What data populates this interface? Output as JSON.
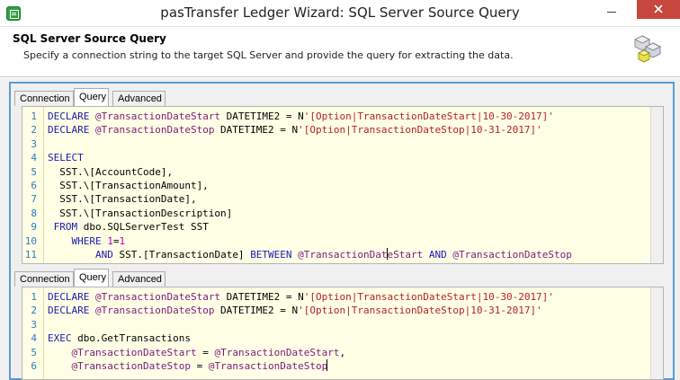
{
  "window": {
    "title": "pasTransfer Ledger Wizard: SQL Server Source Query",
    "minimize": "minimize",
    "maximize": "maximize",
    "close": "close"
  },
  "header": {
    "title": "SQL Server Source Query",
    "description": "Specify a connection string to the target SQL Server and provide the query for extracting the data."
  },
  "top_panel": {
    "tabs": [
      {
        "label": "Connection",
        "active": false
      },
      {
        "label": "Query",
        "active": true
      },
      {
        "label": "Advanced",
        "active": false
      }
    ],
    "lines": [
      {
        "n": "1",
        "tokens": [
          [
            "kw",
            "DECLARE "
          ],
          [
            "var",
            "@TransactionDateStart"
          ],
          [
            "txt",
            " DATETIME2 = N"
          ],
          [
            "str",
            "'[Option|TransactionDateStart|10-30-2017]'"
          ]
        ]
      },
      {
        "n": "2",
        "tokens": [
          [
            "kw",
            "DECLARE "
          ],
          [
            "var",
            "@TransactionDateStop"
          ],
          [
            "txt",
            " DATETIME2 = N"
          ],
          [
            "str",
            "'[Option|TransactionDateStop|10-31-2017]'"
          ]
        ]
      },
      {
        "n": "3",
        "tokens": []
      },
      {
        "n": "4",
        "tokens": [
          [
            "kw",
            "SELECT"
          ]
        ]
      },
      {
        "n": "5",
        "tokens": [
          [
            "txt",
            "  SST.\\[AccountCode],"
          ]
        ]
      },
      {
        "n": "6",
        "tokens": [
          [
            "txt",
            "  SST.\\[TransactionAmount],"
          ]
        ]
      },
      {
        "n": "7",
        "tokens": [
          [
            "txt",
            "  SST.\\[TransactionDate],"
          ]
        ]
      },
      {
        "n": "8",
        "tokens": [
          [
            "txt",
            "  SST.\\[TransactionDescription]"
          ]
        ]
      },
      {
        "n": "9",
        "tokens": [
          [
            "kw",
            " FROM "
          ],
          [
            "txt",
            "dbo.SQLServerTest SST"
          ]
        ]
      },
      {
        "n": "10",
        "tokens": [
          [
            "kw",
            "    WHERE "
          ],
          [
            "num",
            "1"
          ],
          [
            "txt",
            "="
          ],
          [
            "num",
            "1"
          ]
        ]
      },
      {
        "n": "11",
        "tokens": [
          [
            "kw",
            "        AND "
          ],
          [
            "txt",
            "SST.[TransactionDate] "
          ],
          [
            "kw",
            "BETWEEN "
          ],
          [
            "var",
            "@TransactionDat"
          ],
          [
            "caret",
            ""
          ],
          [
            "var",
            "eStart"
          ],
          [
            "kw",
            " AND "
          ],
          [
            "var",
            "@TransactionDateStop"
          ]
        ]
      }
    ]
  },
  "bottom_panel": {
    "tabs": [
      {
        "label": "Connection",
        "active": false
      },
      {
        "label": "Query",
        "active": true
      },
      {
        "label": "Advanced",
        "active": false
      }
    ],
    "lines": [
      {
        "n": "1",
        "tokens": [
          [
            "kw",
            "DECLARE "
          ],
          [
            "var",
            "@TransactionDateStart"
          ],
          [
            "txt",
            " DATETIME2 = N"
          ],
          [
            "str",
            "'[Option|TransactionDateStart|10-30-2017]'"
          ]
        ]
      },
      {
        "n": "2",
        "tokens": [
          [
            "kw",
            "DECLARE "
          ],
          [
            "var",
            "@TransactionDateStop"
          ],
          [
            "txt",
            " DATETIME2 = N"
          ],
          [
            "str",
            "'[Option|TransactionDateStop|10-31-2017]'"
          ]
        ]
      },
      {
        "n": "3",
        "tokens": []
      },
      {
        "n": "4",
        "tokens": [
          [
            "kw",
            "EXEC "
          ],
          [
            "txt",
            "dbo.GetTransactions"
          ]
        ]
      },
      {
        "n": "5",
        "tokens": [
          [
            "var",
            "    @TransactionDateStart"
          ],
          [
            "txt",
            " = "
          ],
          [
            "var",
            "@TransactionDateStart"
          ],
          [
            "txt",
            ","
          ]
        ]
      },
      {
        "n": "6",
        "tokens": [
          [
            "var",
            "    @TransactionDateStop"
          ],
          [
            "txt",
            " = "
          ],
          [
            "var",
            "@TransactionDateStop"
          ],
          [
            "caret",
            ""
          ]
        ]
      }
    ]
  }
}
